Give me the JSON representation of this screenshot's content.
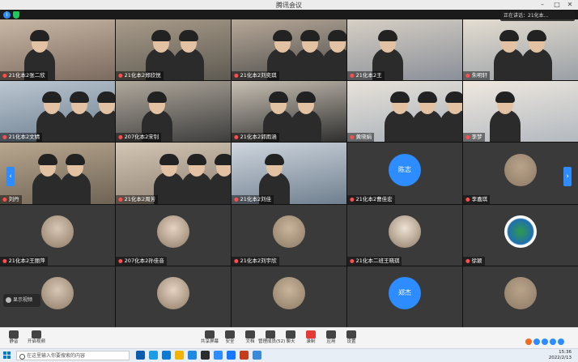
{
  "window": {
    "title": "腾讯会议"
  },
  "top_right_badge": {
    "text": "正在讲话：21化本..."
  },
  "tiles": [
    {
      "name": "21化本2张二欣",
      "kind": "video"
    },
    {
      "name": "21化本2郑欣悦",
      "kind": "video"
    },
    {
      "name": "21化本2刘奕琪",
      "kind": "video"
    },
    {
      "name": "21化本2王",
      "kind": "video"
    },
    {
      "name": "朱明轩",
      "kind": "video"
    },
    {
      "name": "21化本2文婧",
      "kind": "video"
    },
    {
      "name": "207化本2宋钊",
      "kind": "video"
    },
    {
      "name": "21化本2郭雨涵",
      "kind": "video"
    },
    {
      "name": "黄晓娟",
      "kind": "video"
    },
    {
      "name": "李梦",
      "kind": "video"
    },
    {
      "name": "刘丹",
      "kind": "video"
    },
    {
      "name": "21化本2周芳",
      "kind": "video"
    },
    {
      "name": "21化本2刘佳",
      "kind": "video"
    },
    {
      "name": "21化本2曹佳宏",
      "kind": "avatar",
      "avatar_text": "陈志"
    },
    {
      "name": "李嘉琪",
      "kind": "avatar-photo"
    },
    {
      "name": "21化本2王丽萍",
      "kind": "avatar-photo"
    },
    {
      "name": "207化本2孙佳音",
      "kind": "avatar-photo"
    },
    {
      "name": "21化本2刘宇欣",
      "kind": "avatar-photo"
    },
    {
      "name": "21化本二班王晓琪",
      "kind": "avatar-photo"
    },
    {
      "name": "徐颖",
      "kind": "avatar-logo"
    },
    {
      "name": "",
      "kind": "avatar-photo"
    },
    {
      "name": "",
      "kind": "avatar-photo"
    },
    {
      "name": "",
      "kind": "avatar-photo"
    },
    {
      "name": "",
      "kind": "avatar",
      "avatar_text": "郑杰"
    },
    {
      "name": "",
      "kind": "avatar-photo"
    }
  ],
  "self_view": {
    "label": "显示视频"
  },
  "toolbar": {
    "left": [
      {
        "label": "静音",
        "icon": "mic-icon"
      },
      {
        "label": "开启视频",
        "icon": "camera-icon"
      }
    ],
    "center": [
      {
        "label": "共享屏幕",
        "icon": "share-screen-icon"
      },
      {
        "label": "安全",
        "icon": "shield-icon"
      },
      {
        "label": "文档",
        "icon": "document-icon"
      },
      {
        "label": "管理成员(52)",
        "icon": "members-icon"
      },
      {
        "label": "聊天",
        "icon": "chat-icon"
      },
      {
        "label": "录制",
        "icon": "record-icon"
      },
      {
        "label": "应用",
        "icon": "apps-icon"
      },
      {
        "label": "设置",
        "icon": "gear-icon"
      }
    ]
  },
  "taskbar": {
    "search_placeholder": "在这里输入你要搜索的内容",
    "time": "15:36",
    "date": "2022/2/13"
  },
  "colors": {
    "accent": "#2d8cff",
    "toolbar_bg": "#f4f4f4",
    "grid_bg": "#111111"
  }
}
